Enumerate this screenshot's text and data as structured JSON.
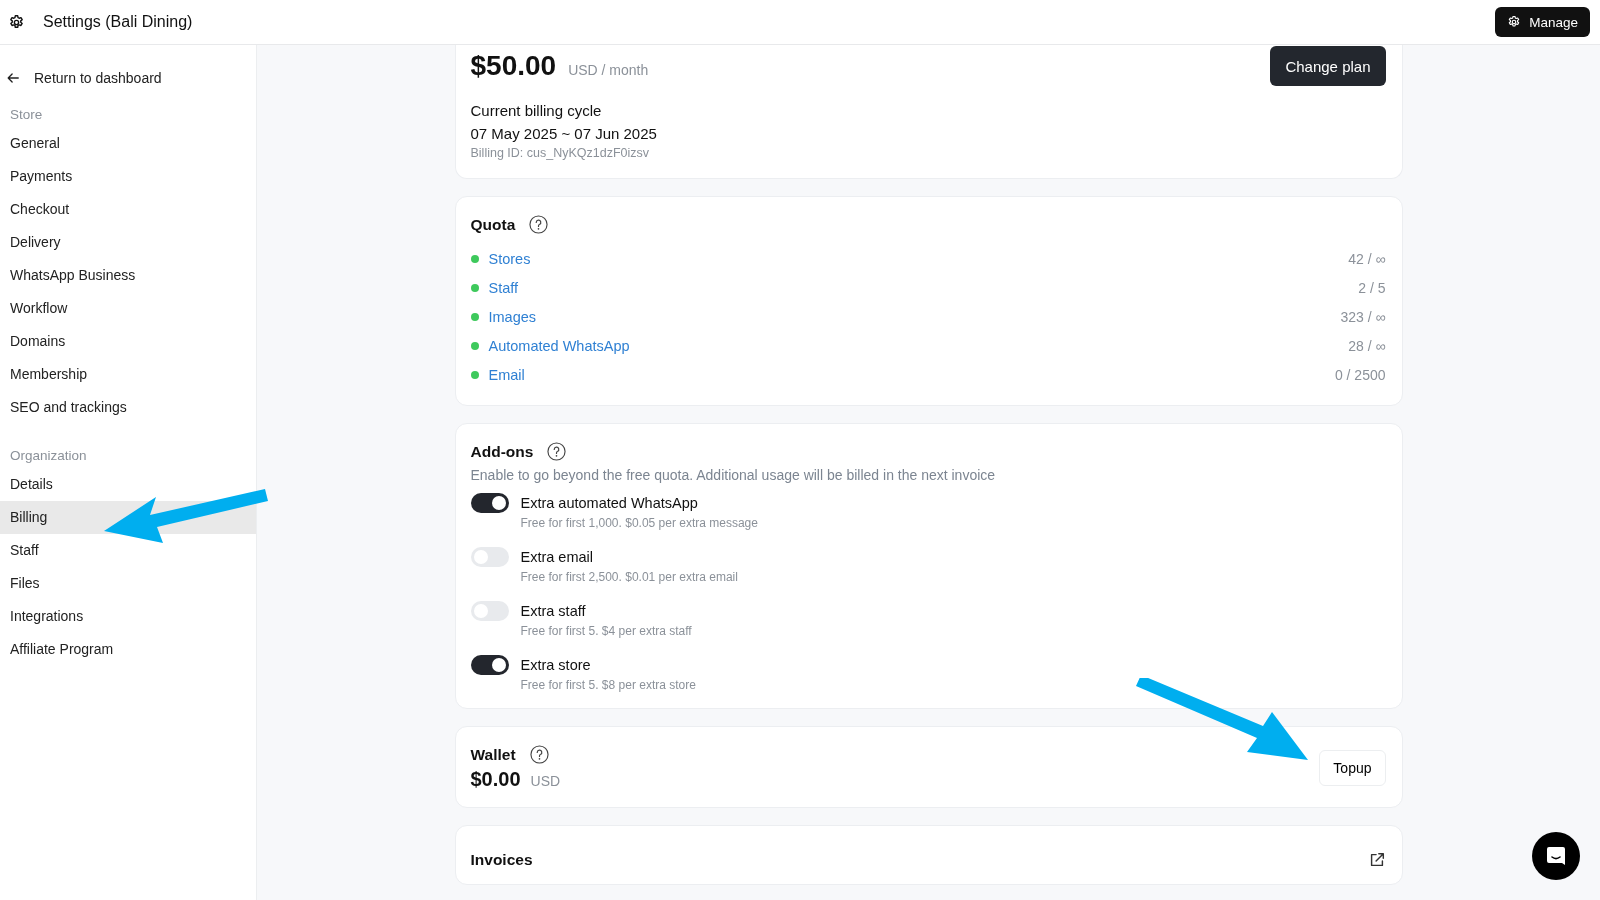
{
  "header": {
    "title": "Settings (Bali Dining)",
    "manage_button": "Manage"
  },
  "sidebar": {
    "back_link": "Return to dashboard",
    "sections": [
      {
        "heading": "Store",
        "items": [
          {
            "label": "General",
            "selected": false
          },
          {
            "label": "Payments",
            "selected": false
          },
          {
            "label": "Checkout",
            "selected": false
          },
          {
            "label": "Delivery",
            "selected": false
          },
          {
            "label": "WhatsApp Business",
            "selected": false
          },
          {
            "label": "Workflow",
            "selected": false
          },
          {
            "label": "Domains",
            "selected": false
          },
          {
            "label": "Membership",
            "selected": false
          },
          {
            "label": "SEO and trackings",
            "selected": false
          }
        ]
      },
      {
        "heading": "Organization",
        "items": [
          {
            "label": "Details",
            "selected": false
          },
          {
            "label": "Billing",
            "selected": true
          },
          {
            "label": "Staff",
            "selected": false
          },
          {
            "label": "Files",
            "selected": false
          },
          {
            "label": "Integrations",
            "selected": false
          },
          {
            "label": "Affiliate Program",
            "selected": false
          }
        ]
      }
    ]
  },
  "plan": {
    "price": "$50.00",
    "unit": "USD / month",
    "button": "Change plan",
    "cycle_label": "Current billing cycle",
    "cycle_dates": "07 May 2025 ~ 07 Jun 2025",
    "billing_id": "Billing ID: cus_NyKQz1dzF0izsv"
  },
  "quota": {
    "title": "Quota",
    "items": [
      {
        "name": "Stores",
        "value": "42 / ∞"
      },
      {
        "name": "Staff",
        "value": "2 / 5"
      },
      {
        "name": "Images",
        "value": "323 / ∞"
      },
      {
        "name": "Automated WhatsApp",
        "value": "28 / ∞"
      },
      {
        "name": "Email",
        "value": "0 / 2500"
      }
    ]
  },
  "addons": {
    "title": "Add-ons",
    "description": "Enable to go beyond the free quota. Additional usage will be billed in the next invoice",
    "items": [
      {
        "name": "Extra automated WhatsApp",
        "note": "Free for first 1,000. $0.05 per extra message",
        "on": true
      },
      {
        "name": "Extra email",
        "note": "Free for first 2,500. $0.01 per extra email",
        "on": false
      },
      {
        "name": "Extra staff",
        "note": "Free for first 5. $4 per extra staff",
        "on": false
      },
      {
        "name": "Extra store",
        "note": "Free for first 5. $8 per extra store",
        "on": true
      }
    ]
  },
  "wallet": {
    "title": "Wallet",
    "amount": "$0.00",
    "currency": "USD",
    "button": "Topup"
  },
  "invoices": {
    "title": "Invoices"
  }
}
